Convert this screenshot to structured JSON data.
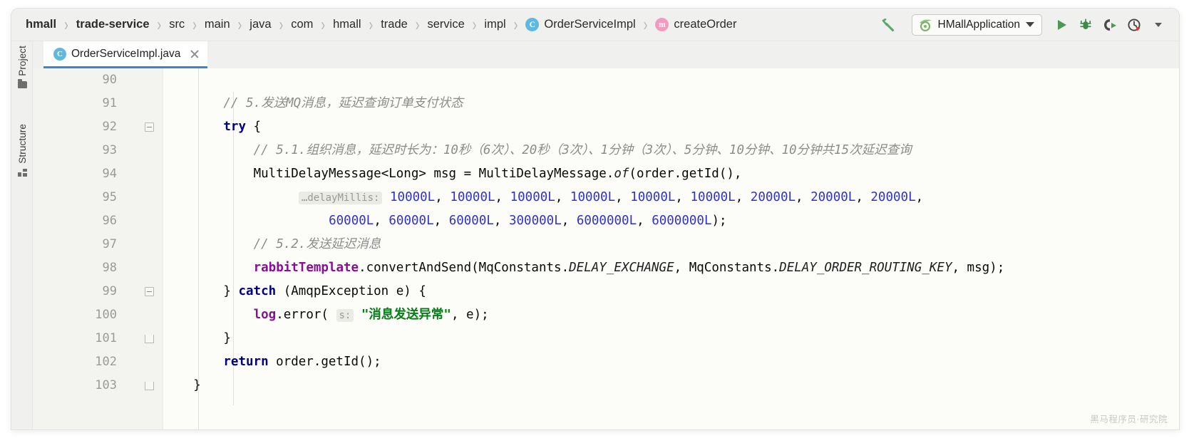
{
  "breadcrumb": {
    "items": [
      {
        "label": "hmall",
        "bold": true,
        "icon": null
      },
      {
        "label": "trade-service",
        "bold": true,
        "icon": null
      },
      {
        "label": "src",
        "bold": false,
        "icon": null
      },
      {
        "label": "main",
        "bold": false,
        "icon": null
      },
      {
        "label": "java",
        "bold": false,
        "icon": null
      },
      {
        "label": "com",
        "bold": false,
        "icon": null
      },
      {
        "label": "hmall",
        "bold": false,
        "icon": null
      },
      {
        "label": "trade",
        "bold": false,
        "icon": null
      },
      {
        "label": "service",
        "bold": false,
        "icon": null
      },
      {
        "label": "impl",
        "bold": false,
        "icon": null
      },
      {
        "label": "OrderServiceImpl",
        "bold": false,
        "icon": "class-icon",
        "icon_letter": "C"
      },
      {
        "label": "createOrder",
        "bold": false,
        "icon": "method-icon",
        "icon_letter": "m"
      }
    ],
    "separator": "›"
  },
  "toolbar": {
    "build_tooltip": "Build Project",
    "run_config": "HMallApplication",
    "run_tooltip": "Run",
    "debug_tooltip": "Debug",
    "coverage_tooltip": "Run with Coverage",
    "profiler_tooltip": "Profiler",
    "more_tooltip": "More"
  },
  "toolwindows": {
    "project_label": "Project",
    "structure_label": "Structure"
  },
  "tab": {
    "title": "OrderServiceImpl.java",
    "icon_letter": "C",
    "close_label": "Close tab"
  },
  "editor": {
    "lines": [
      {
        "num": "90",
        "fold": null,
        "segments": []
      },
      {
        "num": "91",
        "fold": null,
        "segments": [
          {
            "t": "cmt",
            "v": "// 5.发送MQ消息，延迟查询订单支付状态",
            "indent": 8
          }
        ]
      },
      {
        "num": "92",
        "fold": "box",
        "segments": [
          {
            "t": "kw",
            "v": "try",
            "indent": 8
          },
          {
            "t": "plain",
            "v": " {"
          }
        ]
      },
      {
        "num": "93",
        "fold": null,
        "segments": [
          {
            "t": "cmt",
            "v": "// 5.1.组织消息，延迟时长为：10秒（6次）、20秒（3次）、1分钟（3次）、5分钟、10分钟、10分钟共15次延迟查询",
            "indent": 12
          }
        ]
      },
      {
        "num": "94",
        "fold": null,
        "segments": [
          {
            "t": "plain",
            "v": "MultiDelayMessage<Long> msg = MultiDelayMessage.",
            "indent": 12
          },
          {
            "t": "stat",
            "v": "of"
          },
          {
            "t": "plain",
            "v": "(order.getId(),"
          }
        ]
      },
      {
        "num": "95",
        "fold": null,
        "segments": [
          {
            "t": "hint",
            "v": "…delayMillis:",
            "indent": 18
          },
          {
            "t": "num",
            "v": " 10000L"
          },
          {
            "t": "plain",
            "v": ", "
          },
          {
            "t": "num",
            "v": "10000L"
          },
          {
            "t": "plain",
            "v": ", "
          },
          {
            "t": "num",
            "v": "10000L"
          },
          {
            "t": "plain",
            "v": ", "
          },
          {
            "t": "num",
            "v": "10000L"
          },
          {
            "t": "plain",
            "v": ", "
          },
          {
            "t": "num",
            "v": "10000L"
          },
          {
            "t": "plain",
            "v": ", "
          },
          {
            "t": "num",
            "v": "10000L"
          },
          {
            "t": "plain",
            "v": ", "
          },
          {
            "t": "num",
            "v": "20000L"
          },
          {
            "t": "plain",
            "v": ", "
          },
          {
            "t": "num",
            "v": "20000L"
          },
          {
            "t": "plain",
            "v": ", "
          },
          {
            "t": "num",
            "v": "20000L"
          },
          {
            "t": "plain",
            "v": ","
          }
        ]
      },
      {
        "num": "96",
        "fold": null,
        "segments": [
          {
            "t": "num",
            "v": "60000L",
            "indent": 22
          },
          {
            "t": "plain",
            "v": ", "
          },
          {
            "t": "num",
            "v": "60000L"
          },
          {
            "t": "plain",
            "v": ", "
          },
          {
            "t": "num",
            "v": "60000L"
          },
          {
            "t": "plain",
            "v": ", "
          },
          {
            "t": "num",
            "v": "300000L"
          },
          {
            "t": "plain",
            "v": ", "
          },
          {
            "t": "num",
            "v": "6000000L"
          },
          {
            "t": "plain",
            "v": ", "
          },
          {
            "t": "num",
            "v": "6000000L"
          },
          {
            "t": "plain",
            "v": ");"
          }
        ]
      },
      {
        "num": "97",
        "fold": null,
        "segments": [
          {
            "t": "cmt",
            "v": "// 5.2.发送延迟消息",
            "indent": 12
          }
        ]
      },
      {
        "num": "98",
        "fold": null,
        "segments": [
          {
            "t": "fld",
            "v": "rabbitTemplate",
            "indent": 12
          },
          {
            "t": "plain",
            "v": ".convertAndSend(MqConstants."
          },
          {
            "t": "stat",
            "v": "DELAY_EXCHANGE"
          },
          {
            "t": "plain",
            "v": ", MqConstants."
          },
          {
            "t": "stat",
            "v": "DELAY_ORDER_ROUTING_KEY"
          },
          {
            "t": "plain",
            "v": ", msg);"
          }
        ]
      },
      {
        "num": "99",
        "fold": "box",
        "segments": [
          {
            "t": "plain",
            "v": "} ",
            "indent": 8
          },
          {
            "t": "kw",
            "v": "catch"
          },
          {
            "t": "plain",
            "v": " (AmqpException e) {"
          }
        ]
      },
      {
        "num": "100",
        "fold": null,
        "segments": [
          {
            "t": "fld",
            "v": "log",
            "indent": 12
          },
          {
            "t": "plain",
            "v": ".error( "
          },
          {
            "t": "hint",
            "v": "s:"
          },
          {
            "t": "str",
            "v": " \"消息发送异常\""
          },
          {
            "t": "plain",
            "v": ", e);"
          }
        ]
      },
      {
        "num": "101",
        "fold": "arrowend",
        "segments": [
          {
            "t": "plain",
            "v": "}",
            "indent": 8
          }
        ]
      },
      {
        "num": "102",
        "fold": null,
        "segments": [
          {
            "t": "kw",
            "v": "return",
            "indent": 8
          },
          {
            "t": "plain",
            "v": " order.getId();"
          }
        ]
      },
      {
        "num": "103",
        "fold": "arrowend",
        "segments": [
          {
            "t": "plain",
            "v": "}",
            "indent": 4
          }
        ]
      }
    ]
  },
  "watermark": "黑马程序员·研究院"
}
